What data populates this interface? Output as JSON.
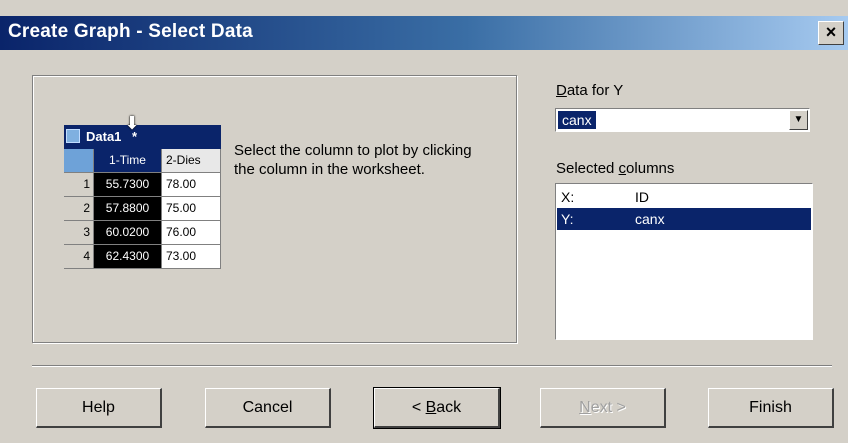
{
  "window": {
    "title": "Create Graph - Select Data",
    "close_glyph": "×"
  },
  "worksheet": {
    "title": "Data1",
    "title_suffix": "*",
    "columns": [
      "1-Time",
      "2-Dies"
    ],
    "rows": [
      {
        "num": "1",
        "c1": "55.7300",
        "c2": "78.00"
      },
      {
        "num": "2",
        "c1": "57.8800",
        "c2": "75.00"
      },
      {
        "num": "3",
        "c1": "60.0200",
        "c2": "76.00"
      },
      {
        "num": "4",
        "c1": "62.4300",
        "c2": "73.00"
      }
    ],
    "pointer_icon": "column-select-pointer-icon",
    "pointer_glyph": "⬇"
  },
  "instructions": "Select the column to plot by clicking the column in the worksheet.",
  "data_for_y": {
    "label_prefix": "D",
    "label_rest": "ata for Y",
    "value": "canx",
    "dropdown_glyph": "▼"
  },
  "selected_columns": {
    "label_prefix": "Selected ",
    "label_u": "c",
    "label_rest": "olumns",
    "items": [
      {
        "key": "X:",
        "value": "ID",
        "selected": false
      },
      {
        "key": "Y:",
        "value": "canx",
        "selected": true
      }
    ]
  },
  "buttons": {
    "help": "Help",
    "cancel": "Cancel",
    "back_prefix": "< ",
    "back_u": "B",
    "back_rest": "ack",
    "next_u": "N",
    "next_rest": "ext >",
    "finish": "Finish"
  },
  "colors": {
    "title_bar": "#0a246a",
    "selection": "#0a246a",
    "face": "#d4d0c8"
  }
}
